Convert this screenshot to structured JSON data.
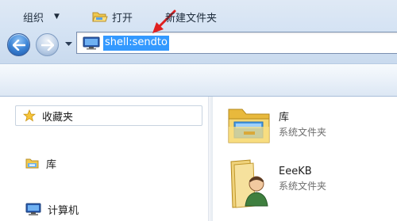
{
  "address_bar": {
    "path": "shell:sendto",
    "icon": "computer-icon"
  },
  "navigation": {
    "back_icon": "back-arrow-icon",
    "forward_icon": "forward-arrow-icon",
    "dropdown_icon": "chevron-down-icon"
  },
  "toolbar": {
    "organize_label": "组织",
    "open_label": "打开",
    "new_folder_label": "新建文件夹"
  },
  "nav_pane": {
    "favorites_label": "收藏夹",
    "libraries_label": "库",
    "computer_label": "计算机"
  },
  "content": {
    "items": [
      {
        "name": "库",
        "type": "系统文件夹",
        "icon": "library-folder-icon"
      },
      {
        "name": "EeeKB",
        "type": "系统文件夹",
        "icon": "user-folder-icon"
      }
    ]
  },
  "colors": {
    "selection": "#3399ff",
    "annotation_arrow": "#e02020",
    "toolbar_top": "#f7fafd",
    "toolbar_bottom": "#dce7f4"
  }
}
